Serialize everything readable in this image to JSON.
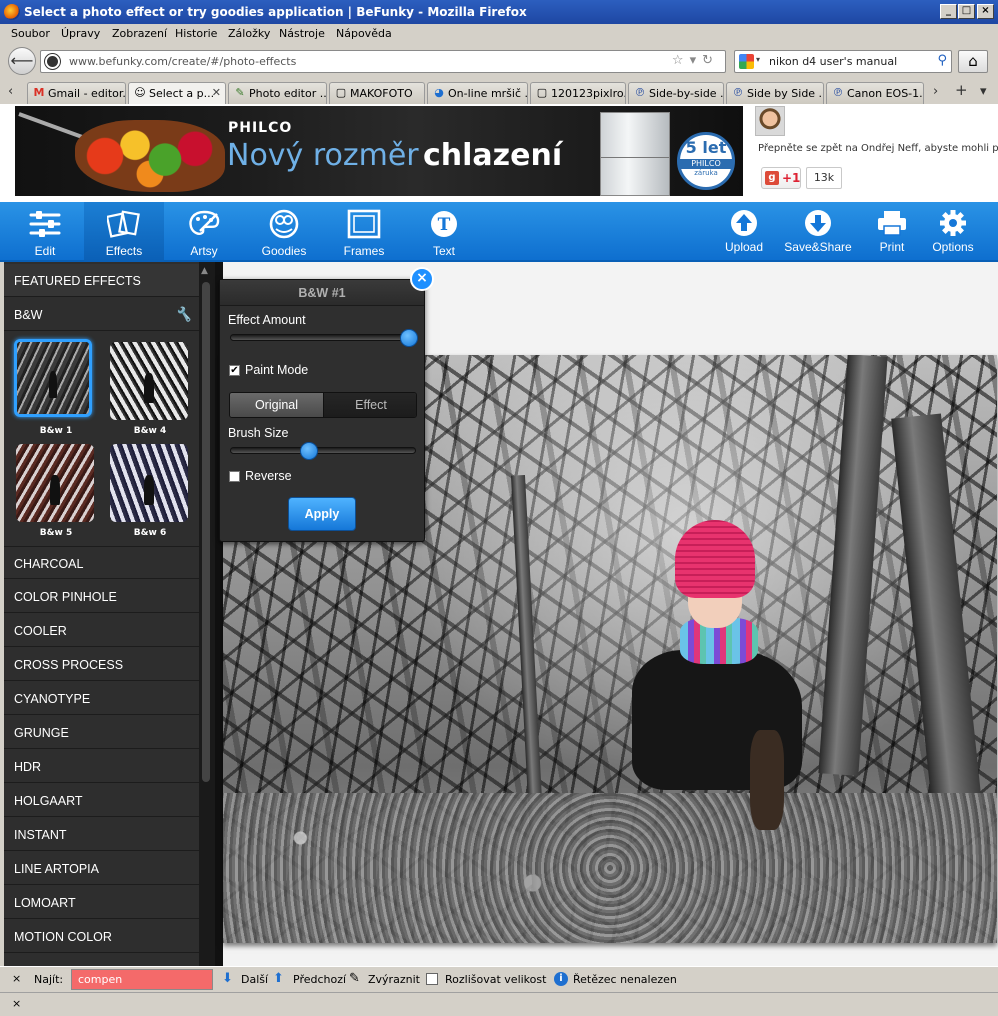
{
  "window": {
    "title": "Select a photo effect or try goodies application | BeFunky - Mozilla Firefox",
    "buttons": {
      "minimize": "_",
      "maximize": "□",
      "close": "×"
    }
  },
  "menu": [
    "Soubor",
    "Úpravy",
    "Zobrazení",
    "Historie",
    "Záložky",
    "Nástroje",
    "Nápověda"
  ],
  "nav": {
    "url": "www.befunky.com/create/#/photo-effects",
    "search_value": "nikon d4 user's manual"
  },
  "tabs": [
    {
      "label": "Gmail - editor...",
      "icon": "M"
    },
    {
      "label": "Select a p...",
      "icon": "☺",
      "active": true
    },
    {
      "label": "Photo editor ...",
      "icon": "✎"
    },
    {
      "label": "MAKOFOTO",
      "icon": "▢"
    },
    {
      "label": "On-line mršič ...",
      "icon": "◕"
    },
    {
      "label": "120123pixlro...",
      "icon": "▢"
    },
    {
      "label": "Side-by-side ...",
      "icon": "℗"
    },
    {
      "label": "Side by Side ...",
      "icon": "℗"
    },
    {
      "label": "Canon EOS-1...",
      "icon": "℗"
    }
  ],
  "ad": {
    "brand": "PHILCO",
    "slogan_part1": "Nový rozměr",
    "slogan_part2": "chlazení",
    "badge_top": "5 let",
    "badge_mid": "PHILCO",
    "badge_bottom": "záruka"
  },
  "social": {
    "text": "Přepněte se zpět na Ondřej Neff, abyste mohli po",
    "gplus_label": "+1",
    "count": "13k"
  },
  "toolbar": {
    "left": [
      {
        "label": "Edit",
        "icon": "sliders-icon"
      },
      {
        "label": "Effects",
        "icon": "effects-icon",
        "active": true
      },
      {
        "label": "Artsy",
        "icon": "palette-icon"
      },
      {
        "label": "Goodies",
        "icon": "goodies-icon"
      },
      {
        "label": "Frames",
        "icon": "frame-icon"
      },
      {
        "label": "Text",
        "icon": "text-icon"
      }
    ],
    "right": [
      {
        "label": "Upload",
        "icon": "upload-icon"
      },
      {
        "label": "Save&Share",
        "icon": "save-share-icon"
      },
      {
        "label": "Print",
        "icon": "print-icon"
      },
      {
        "label": "Options",
        "icon": "gear-icon"
      }
    ]
  },
  "effects_panel": {
    "featured": "FEATURED EFFECTS",
    "bw_header": "B&W",
    "thumbs": [
      "B&w 1",
      "B&w 4",
      "B&w 5",
      "B&w 6"
    ],
    "categories": [
      "CHARCOAL",
      "COLOR PINHOLE",
      "COOLER",
      "CROSS PROCESS",
      "CYANOTYPE",
      "GRUNGE",
      "HDR",
      "HOLGAART",
      "INSTANT",
      "LINE ARTOPIA",
      "LOMOART",
      "MOTION COLOR"
    ]
  },
  "fx_popup": {
    "title": "B&W #1",
    "effect_amount_label": "Effect Amount",
    "effect_amount": 1.0,
    "paint_mode_label": "Paint Mode",
    "paint_mode_checked": true,
    "seg_original": "Original",
    "seg_effect": "Effect",
    "brush_size_label": "Brush Size",
    "brush_size": 0.42,
    "reverse_label": "Reverse",
    "reverse_checked": false,
    "apply_label": "Apply",
    "close_glyph": "×"
  },
  "findbar": {
    "close": "×",
    "label": "Najít:",
    "value": "compen",
    "next": "Další",
    "prev": "Předchozí",
    "highlight": "Zvýraznit",
    "match_case": "Rozlišovat velikost",
    "status": "Řetězec nenalezen"
  },
  "statusbar": {
    "close": "×"
  }
}
